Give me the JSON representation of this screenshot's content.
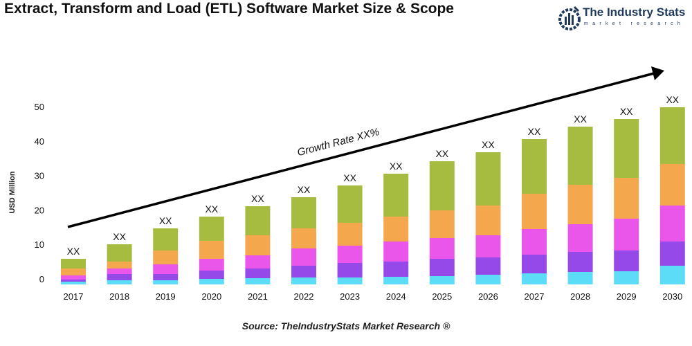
{
  "title": "Extract, Transform and Load (ETL) Software Market Size & Scope",
  "logo": {
    "name": "The Industry Stats",
    "tagline": "market research"
  },
  "source": "Source: TheIndustryStats Market Research ®",
  "chart_data": {
    "type": "bar",
    "stacked": true,
    "title": "Extract, Transform and Load (ETL) Software Market Size & Scope",
    "ylabel": "USD Million",
    "xlabel": "",
    "ylim": [
      0,
      50
    ],
    "yticks": [
      0,
      10,
      20,
      30,
      40,
      50
    ],
    "grid": false,
    "categories": [
      "2017",
      "2018",
      "2019",
      "2020",
      "2021",
      "2022",
      "2023",
      "2024",
      "2025",
      "2026",
      "2027",
      "2028",
      "2029",
      "2030"
    ],
    "series": [
      {
        "color": "#5ddcf8",
        "values": [
          0.8,
          1.2,
          1.2,
          1.6,
          1.8,
          2,
          2,
          2.2,
          2.4,
          2.8,
          3.2,
          3.6,
          3.8,
          5.4
        ]
      },
      {
        "color": "#9549e8",
        "values": [
          0.6,
          1.8,
          1.8,
          2.4,
          2.8,
          3.4,
          4.2,
          4.4,
          5,
          5,
          5.4,
          5.8,
          6,
          7
        ]
      },
      {
        "color": "#ea56ea",
        "values": [
          1.2,
          1.6,
          2.8,
          3.4,
          3.8,
          5,
          5,
          5.8,
          6,
          6.4,
          7.4,
          8,
          9.2,
          10.4
        ]
      },
      {
        "color": "#f4a74c",
        "values": [
          2,
          2,
          4,
          5.2,
          5.8,
          5.8,
          6.6,
          7.2,
          8,
          8.6,
          10.2,
          11.4,
          11.8,
          12
        ]
      },
      {
        "color": "#a6bc41",
        "values": [
          2.8,
          5,
          6.4,
          7,
          8.4,
          9,
          10.8,
          12.4,
          14.2,
          15.4,
          15.8,
          16.8,
          17,
          16.4
        ]
      }
    ],
    "data_labels": [
      "XX",
      "XX",
      "XX",
      "XX",
      "XX",
      "XX",
      "XX",
      "XX",
      "XX",
      "XX",
      "XX",
      "XX",
      "XX",
      "XX"
    ],
    "annotation": "Growth Rate XX%"
  }
}
